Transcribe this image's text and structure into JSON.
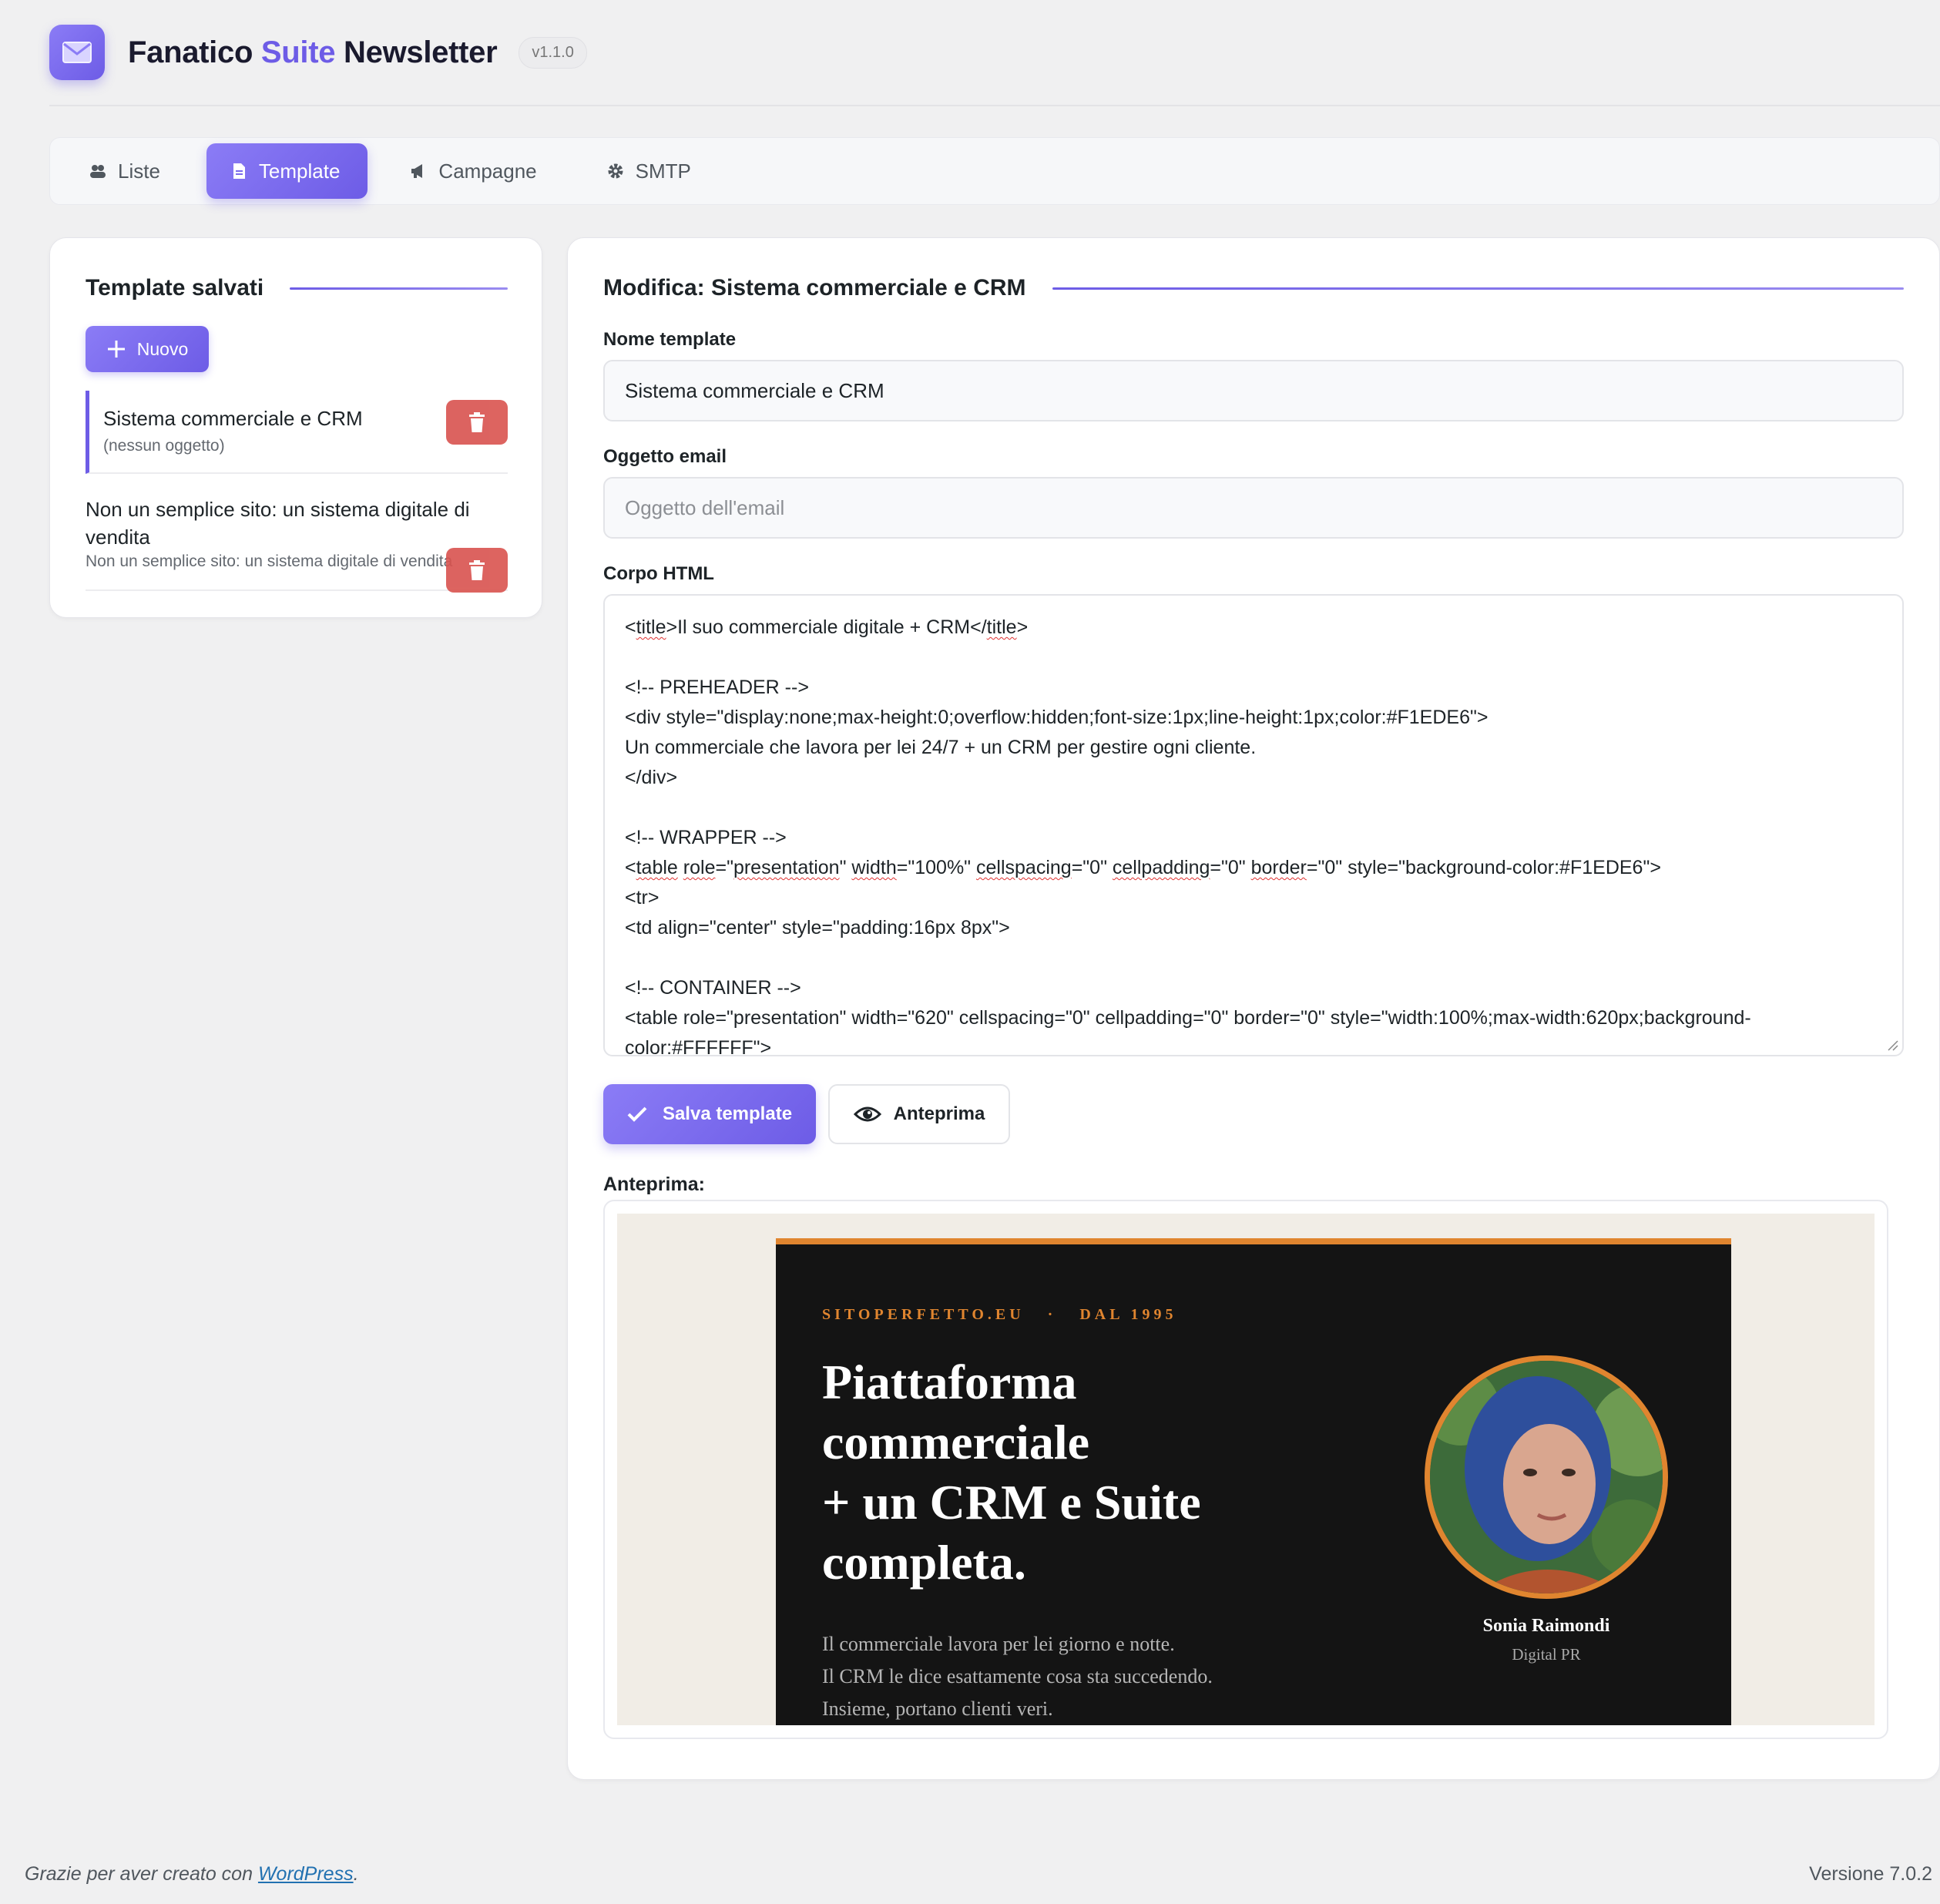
{
  "header": {
    "title_part1": "Fanatico",
    "title_accent": "Suite",
    "title_part2": "Newsletter",
    "version": "v1.1.0",
    "logo_icon": "mail-icon",
    "accent_color": "#6d5ce6"
  },
  "tabs": [
    {
      "label": "Liste",
      "icon": "users-icon",
      "active": false
    },
    {
      "label": "Template",
      "icon": "document-icon",
      "active": true
    },
    {
      "label": "Campagne",
      "icon": "megaphone-icon",
      "active": false
    },
    {
      "label": "SMTP",
      "icon": "gear-icon",
      "active": false
    }
  ],
  "saved_templates": {
    "title": "Template salvati",
    "new_button": "Nuovo",
    "items": [
      {
        "name": "Sistema commerciale e CRM",
        "subject": "(nessun oggetto)",
        "selected": true
      },
      {
        "name": "Non un semplice sito: un sistema digitale di vendita",
        "subject": "Non un semplice sito: un sistema digitale di vendita",
        "selected": false
      }
    ]
  },
  "editor": {
    "title": "Modifica: Sistema commerciale e CRM",
    "name_label": "Nome template",
    "name_value": "Sistema commerciale e CRM",
    "subject_label": "Oggetto email",
    "subject_placeholder": "Oggetto dell'email",
    "subject_value": "",
    "body_label": "Corpo HTML",
    "body_lines": [
      "<title>Il suo commerciale digitale + CRM</title>",
      "",
      "<!-- PREHEADER -->",
      "<div style=\"display:none;max-height:0;overflow:hidden;font-size:1px;line-height:1px;color:#F1EDE6\">",
      "Un commerciale che lavora per lei 24/7 + un CRM per gestire ogni cliente.",
      "</div>",
      "",
      "<!-- WRAPPER -->",
      "<table role=\"presentation\" width=\"100%\" cellspacing=\"0\" cellpadding=\"0\" border=\"0\" style=\"background-color:#F1EDE6\">",
      "<tr>",
      "<td align=\"center\" style=\"padding:16px 8px\">",
      "",
      "<!-- CONTAINER -->",
      "<table role=\"presentation\" width=\"620\" cellspacing=\"0\" cellpadding=\"0\" border=\"0\" style=\"width:100%;max-width:620px;background-color:#FFFFFF\">"
    ],
    "save_button": "Salva template",
    "preview_button": "Anteprima",
    "preview_label": "Anteprima:"
  },
  "email_preview": {
    "eyebrow_site": "SITOPERFETTO.EU",
    "eyebrow_sep": "·",
    "eyebrow_since": "DAL 1995",
    "headline_lines": [
      "Piattaforma",
      "commerciale",
      "+ un CRM e Suite",
      "completa."
    ],
    "body_lines": [
      "Il commerciale lavora per lei giorno e notte.",
      "Il CRM le dice esattamente cosa sta succedendo.",
      "Insieme, portano clienti veri."
    ],
    "person_name": "Sonia Raimondi",
    "person_role": "Digital PR",
    "accent_color": "#e0852f",
    "background_color": "#f1ede6"
  },
  "footer": {
    "thanks_text": "Grazie per aver creato con",
    "thanks_link": "WordPress",
    "thanks_end": ".",
    "version_text": "Versione 7.0.2"
  }
}
